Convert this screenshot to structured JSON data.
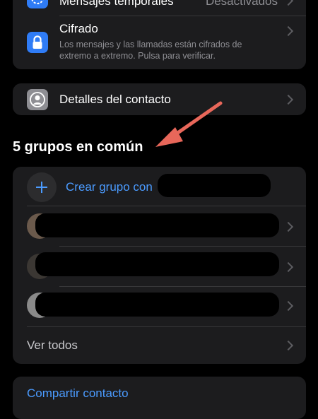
{
  "settings_card": {
    "temp_messages": {
      "label": "Mensajes temporales",
      "value": "Desactivados",
      "icon": "timer-icon"
    },
    "encryption": {
      "title": "Cifrado",
      "description_line1": "Los mensajes y las llamadas están cifrados de",
      "description_line2": "extremo a extremo. Pulsa para verificar.",
      "icon": "lock-icon"
    }
  },
  "contact_details": {
    "label": "Detalles del contacto",
    "icon": "person-circle-icon"
  },
  "groups_section": {
    "heading": "5 grupos en común",
    "create_group_label": "Crear grupo con",
    "see_all_label": "Ver todos"
  },
  "share_contact": {
    "label": "Compartir contacto"
  },
  "colors": {
    "background": "#000000",
    "card": "#1c1c1e",
    "accent_blue": "#3b82f6",
    "link_blue": "#4b9bff",
    "annotation_arrow": "#e8675a"
  }
}
